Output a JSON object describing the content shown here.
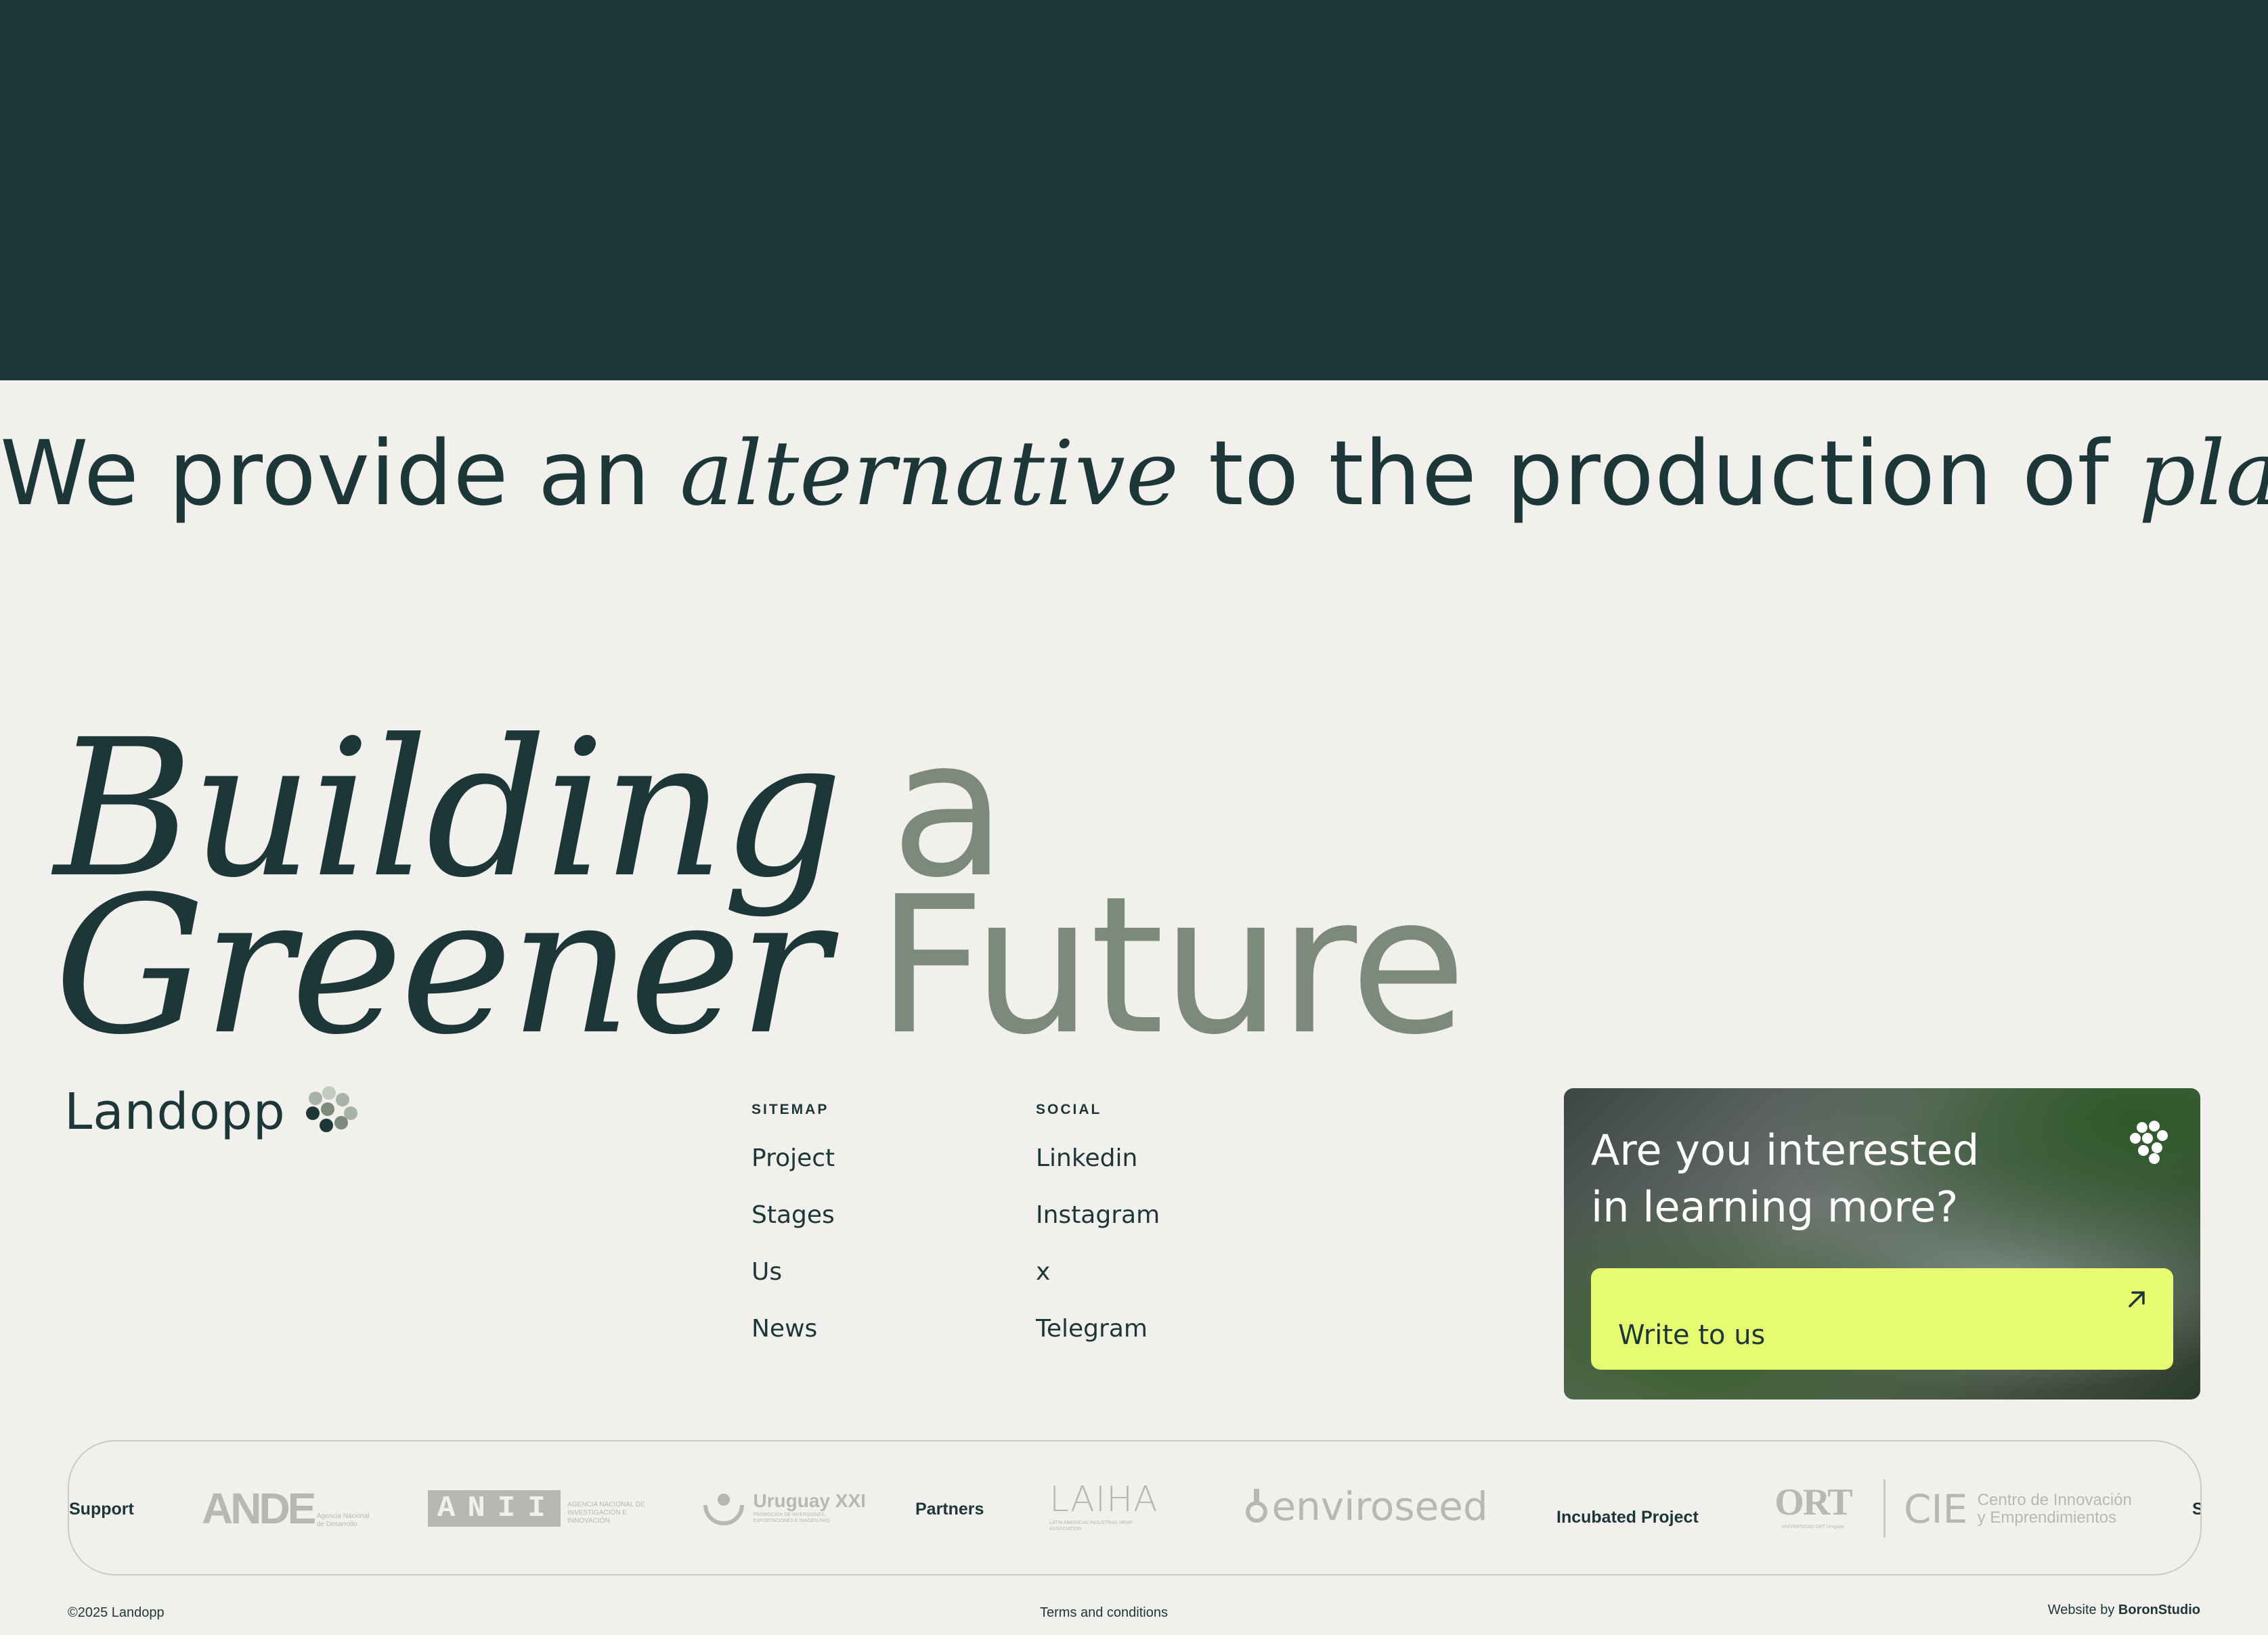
{
  "marquee": {
    "part1": "We provide an ",
    "part2": "alternative",
    "part3": " to the production of ",
    "part4": "plastic-coat"
  },
  "headline": {
    "line1_italic": "Building",
    "line1_plain": "a",
    "line2_italic": "Greener",
    "line2_plain": "Future"
  },
  "brand": {
    "name": "Landopp"
  },
  "sitemap": {
    "title": "SITEMAP",
    "items": [
      "Project",
      "Stages",
      "Us",
      "News"
    ]
  },
  "social": {
    "title": "SOCIAL",
    "items": [
      "Linkedin",
      "Instagram",
      "x",
      "Telegram"
    ]
  },
  "cta": {
    "title": "Are you interested in learning more?",
    "button_label": "Write to us"
  },
  "partners": {
    "support_label": "Support",
    "partners_label": "Partners",
    "incubated_label": "Incubated Project",
    "trailing_label": "S",
    "logos": {
      "ande": "ANDE",
      "ande_sub": "Agencia Nacional de Desarrollo",
      "anii": "ANII",
      "anii_sub": "AGENCIA NACIONAL DE INVESTIGACIÓN E INNOVACIÓN",
      "uruguay": "Uruguay XXI",
      "uruguay_sub": "PROMOCIÓN DE INVERSIONES, EXPORTACIONES E IMAGEN PAÍS",
      "laiha": "LAIHA",
      "laiha_sub": "LATIN AMERICAN INDUSTRIAL HEMP ASSOCIATION",
      "enviroseed": "enviroseed",
      "ort": "ORT",
      "ort_sub": "UNIVERSIDAD ORT Uruguay",
      "cie": "CIE",
      "cie_sub1": "Centro de Innovación",
      "cie_sub2": "y Emprendimientos"
    }
  },
  "footer": {
    "copyright": "©2025 Landopp",
    "terms": "Terms and conditions",
    "credit_prefix": "Website by ",
    "credit_name": "BoronStudio"
  },
  "colors": {
    "dark": "#1d3638",
    "background": "#f2f0ec",
    "accent": "#e6fb72",
    "muted": "#7b8a7a"
  }
}
